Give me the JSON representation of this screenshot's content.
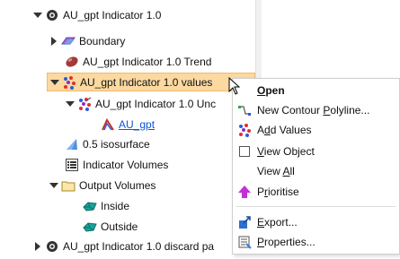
{
  "tree": {
    "rows": [
      {
        "label": "AU_gpt Indicator 1.0"
      },
      {
        "label": "Boundary"
      },
      {
        "label": "AU_gpt Indicator 1.0 Trend"
      },
      {
        "label": "AU_gpt Indicator 1.0 values"
      },
      {
        "label": "AU_gpt Indicator 1.0 Unc"
      },
      {
        "label": "AU_gpt"
      },
      {
        "label": "0.5 isosurface"
      },
      {
        "label": "Indicator Volumes"
      },
      {
        "label": "Output Volumes"
      },
      {
        "label": "Inside"
      },
      {
        "label": "Outside"
      },
      {
        "label": "AU_gpt Indicator 1.0 discard pa"
      }
    ]
  },
  "context_menu": {
    "items": [
      {
        "label": "Open",
        "underline": "O"
      },
      {
        "label": "New Contour Polyline...",
        "underline": "P"
      },
      {
        "label": "Add Values",
        "underline": "d"
      },
      {
        "label": "View Object",
        "underline": "V"
      },
      {
        "label": "View All",
        "underline": "A"
      },
      {
        "label": "Prioritise",
        "underline": "r"
      },
      {
        "label": "Export...",
        "underline": "E"
      },
      {
        "label": "Properties...",
        "underline": "P"
      }
    ]
  },
  "colors": {
    "selection_bg": "#fbd9a1",
    "link": "#0b55d6",
    "prioritise_arrow": "#c22fd6"
  }
}
